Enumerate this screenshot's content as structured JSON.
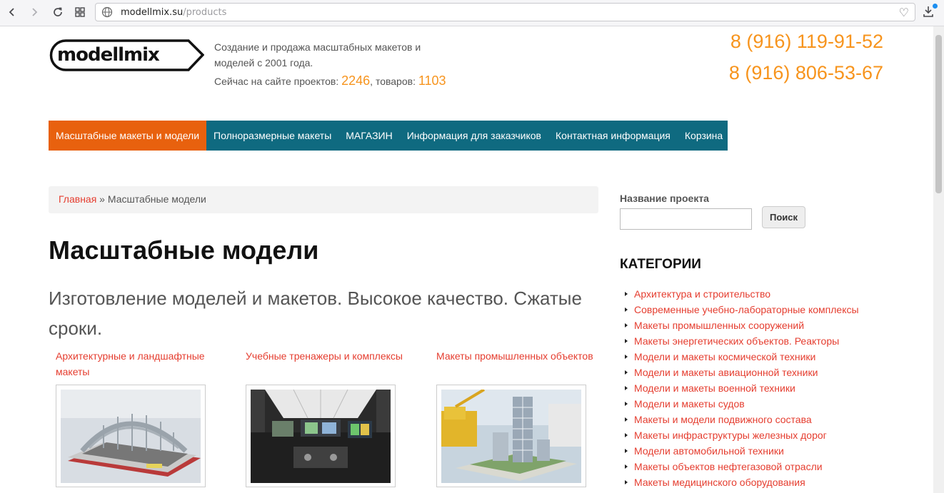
{
  "browser": {
    "url_domain": "modellmix.su",
    "url_path": "/products"
  },
  "header": {
    "logo_text": "modellmix",
    "tagline": "Создание и продажа масштабных макетов и моделей с 2001 года.",
    "stats_prefix": "Сейчас на сайте проектов: ",
    "projects_count": "2246",
    "stats_middle": ", товаров: ",
    "products_count": "1103",
    "phone1": "8 (916) 119-91-52",
    "phone2": "8 (916) 806-53-67"
  },
  "menu": {
    "items": [
      {
        "label": "Масштабные макеты и модели"
      },
      {
        "label": "Полноразмерные макеты"
      },
      {
        "label": "МАГАЗИН"
      },
      {
        "label": "Информация для заказчиков"
      },
      {
        "label": "Контактная информация"
      },
      {
        "label": "Корзина"
      }
    ]
  },
  "breadcrumb": {
    "home": "Главная",
    "separator": " » ",
    "current": "Масштабные модели"
  },
  "main": {
    "title": "Масштабные модели",
    "subtitle": "Изготовление моделей и макетов. Высокое качество. Сжатые сроки.",
    "cards": [
      {
        "title": "Архитектурные и ландшафтные макеты"
      },
      {
        "title": "Учебные тренажеры и комплексы"
      },
      {
        "title": "Макеты промышленных объектов"
      }
    ]
  },
  "sidebar": {
    "search_label": "Название проекта",
    "search_button": "Поиск",
    "categories_heading": "КАТЕГОРИИ",
    "categories": [
      "Архитектура и строительство",
      "Современные учебно-лабораторные комплексы",
      "Макеты промышленных сооружений",
      "Макеты энергетических объектов. Реакторы",
      "Модели и макеты космической техники",
      "Модели и макеты авиационной техники",
      "Модели и макеты военной техники",
      "Модели и макеты судов",
      "Макеты и модели подвижного состава",
      "Макеты инфраструктуры железных дорог",
      "Модели автомобильной техники",
      "Макеты объектов нефтегазовой отрасли",
      "Макеты медицинского оборудования"
    ]
  },
  "colors": {
    "accent_orange": "#f7941d",
    "menu_teal": "#0f6a80",
    "menu_active": "#e8610e",
    "link_red": "#e53d2f"
  }
}
